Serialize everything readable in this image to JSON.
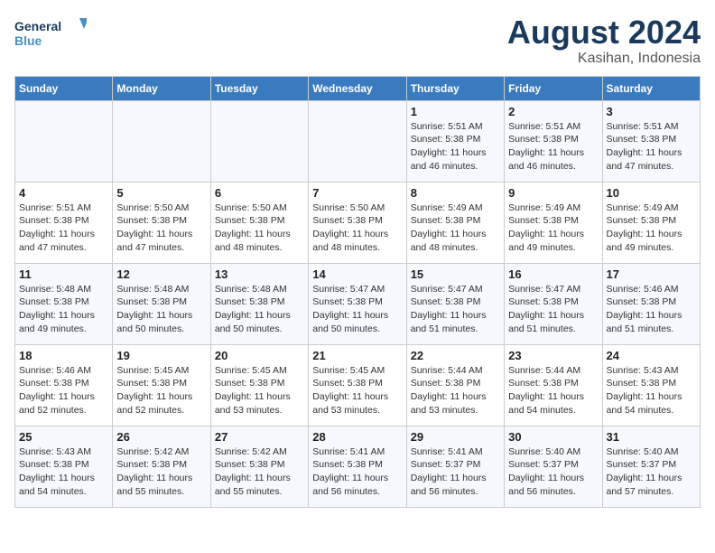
{
  "header": {
    "logo_line1": "General",
    "logo_line2": "Blue",
    "title": "August 2024",
    "subtitle": "Kasihan, Indonesia"
  },
  "days_of_week": [
    "Sunday",
    "Monday",
    "Tuesday",
    "Wednesday",
    "Thursday",
    "Friday",
    "Saturday"
  ],
  "weeks": [
    [
      {
        "day": "",
        "info": ""
      },
      {
        "day": "",
        "info": ""
      },
      {
        "day": "",
        "info": ""
      },
      {
        "day": "",
        "info": ""
      },
      {
        "day": "1",
        "info": "Sunrise: 5:51 AM\nSunset: 5:38 PM\nDaylight: 11 hours\nand 46 minutes."
      },
      {
        "day": "2",
        "info": "Sunrise: 5:51 AM\nSunset: 5:38 PM\nDaylight: 11 hours\nand 46 minutes."
      },
      {
        "day": "3",
        "info": "Sunrise: 5:51 AM\nSunset: 5:38 PM\nDaylight: 11 hours\nand 47 minutes."
      }
    ],
    [
      {
        "day": "4",
        "info": "Sunrise: 5:51 AM\nSunset: 5:38 PM\nDaylight: 11 hours\nand 47 minutes."
      },
      {
        "day": "5",
        "info": "Sunrise: 5:50 AM\nSunset: 5:38 PM\nDaylight: 11 hours\nand 47 minutes."
      },
      {
        "day": "6",
        "info": "Sunrise: 5:50 AM\nSunset: 5:38 PM\nDaylight: 11 hours\nand 48 minutes."
      },
      {
        "day": "7",
        "info": "Sunrise: 5:50 AM\nSunset: 5:38 PM\nDaylight: 11 hours\nand 48 minutes."
      },
      {
        "day": "8",
        "info": "Sunrise: 5:49 AM\nSunset: 5:38 PM\nDaylight: 11 hours\nand 48 minutes."
      },
      {
        "day": "9",
        "info": "Sunrise: 5:49 AM\nSunset: 5:38 PM\nDaylight: 11 hours\nand 49 minutes."
      },
      {
        "day": "10",
        "info": "Sunrise: 5:49 AM\nSunset: 5:38 PM\nDaylight: 11 hours\nand 49 minutes."
      }
    ],
    [
      {
        "day": "11",
        "info": "Sunrise: 5:48 AM\nSunset: 5:38 PM\nDaylight: 11 hours\nand 49 minutes."
      },
      {
        "day": "12",
        "info": "Sunrise: 5:48 AM\nSunset: 5:38 PM\nDaylight: 11 hours\nand 50 minutes."
      },
      {
        "day": "13",
        "info": "Sunrise: 5:48 AM\nSunset: 5:38 PM\nDaylight: 11 hours\nand 50 minutes."
      },
      {
        "day": "14",
        "info": "Sunrise: 5:47 AM\nSunset: 5:38 PM\nDaylight: 11 hours\nand 50 minutes."
      },
      {
        "day": "15",
        "info": "Sunrise: 5:47 AM\nSunset: 5:38 PM\nDaylight: 11 hours\nand 51 minutes."
      },
      {
        "day": "16",
        "info": "Sunrise: 5:47 AM\nSunset: 5:38 PM\nDaylight: 11 hours\nand 51 minutes."
      },
      {
        "day": "17",
        "info": "Sunrise: 5:46 AM\nSunset: 5:38 PM\nDaylight: 11 hours\nand 51 minutes."
      }
    ],
    [
      {
        "day": "18",
        "info": "Sunrise: 5:46 AM\nSunset: 5:38 PM\nDaylight: 11 hours\nand 52 minutes."
      },
      {
        "day": "19",
        "info": "Sunrise: 5:45 AM\nSunset: 5:38 PM\nDaylight: 11 hours\nand 52 minutes."
      },
      {
        "day": "20",
        "info": "Sunrise: 5:45 AM\nSunset: 5:38 PM\nDaylight: 11 hours\nand 53 minutes."
      },
      {
        "day": "21",
        "info": "Sunrise: 5:45 AM\nSunset: 5:38 PM\nDaylight: 11 hours\nand 53 minutes."
      },
      {
        "day": "22",
        "info": "Sunrise: 5:44 AM\nSunset: 5:38 PM\nDaylight: 11 hours\nand 53 minutes."
      },
      {
        "day": "23",
        "info": "Sunrise: 5:44 AM\nSunset: 5:38 PM\nDaylight: 11 hours\nand 54 minutes."
      },
      {
        "day": "24",
        "info": "Sunrise: 5:43 AM\nSunset: 5:38 PM\nDaylight: 11 hours\nand 54 minutes."
      }
    ],
    [
      {
        "day": "25",
        "info": "Sunrise: 5:43 AM\nSunset: 5:38 PM\nDaylight: 11 hours\nand 54 minutes."
      },
      {
        "day": "26",
        "info": "Sunrise: 5:42 AM\nSunset: 5:38 PM\nDaylight: 11 hours\nand 55 minutes."
      },
      {
        "day": "27",
        "info": "Sunrise: 5:42 AM\nSunset: 5:38 PM\nDaylight: 11 hours\nand 55 minutes."
      },
      {
        "day": "28",
        "info": "Sunrise: 5:41 AM\nSunset: 5:38 PM\nDaylight: 11 hours\nand 56 minutes."
      },
      {
        "day": "29",
        "info": "Sunrise: 5:41 AM\nSunset: 5:37 PM\nDaylight: 11 hours\nand 56 minutes."
      },
      {
        "day": "30",
        "info": "Sunrise: 5:40 AM\nSunset: 5:37 PM\nDaylight: 11 hours\nand 56 minutes."
      },
      {
        "day": "31",
        "info": "Sunrise: 5:40 AM\nSunset: 5:37 PM\nDaylight: 11 hours\nand 57 minutes."
      }
    ]
  ]
}
